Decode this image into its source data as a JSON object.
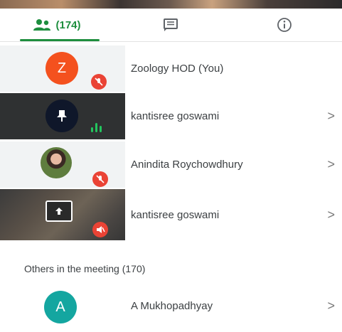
{
  "tabs": {
    "people_count": "(174)"
  },
  "participants": [
    {
      "name": "Zoology HOD (You)",
      "avatar_letter": "Z",
      "chevron": ""
    },
    {
      "name": "kantisree goswami",
      "chevron": ">"
    },
    {
      "name": "Anindita Roychowdhury",
      "chevron": ">"
    },
    {
      "name": "kantisree goswami",
      "chevron": ">"
    }
  ],
  "others_section": {
    "title": "Others in the meeting (170)",
    "items": [
      {
        "name": "A Mukhopadhyay",
        "avatar_letter": "A",
        "chevron": ">"
      }
    ]
  },
  "colors": {
    "accent": "#1e8e3e",
    "muted_badge": "#ea4335",
    "avatar_z": "#f4511e",
    "avatar_a": "#14a6a0"
  },
  "icons": [
    "people-icon",
    "chat-icon",
    "info-icon",
    "mic-off-icon",
    "pin-icon",
    "audio-level-icon",
    "present-screen-icon",
    "chevron-right-icon"
  ]
}
